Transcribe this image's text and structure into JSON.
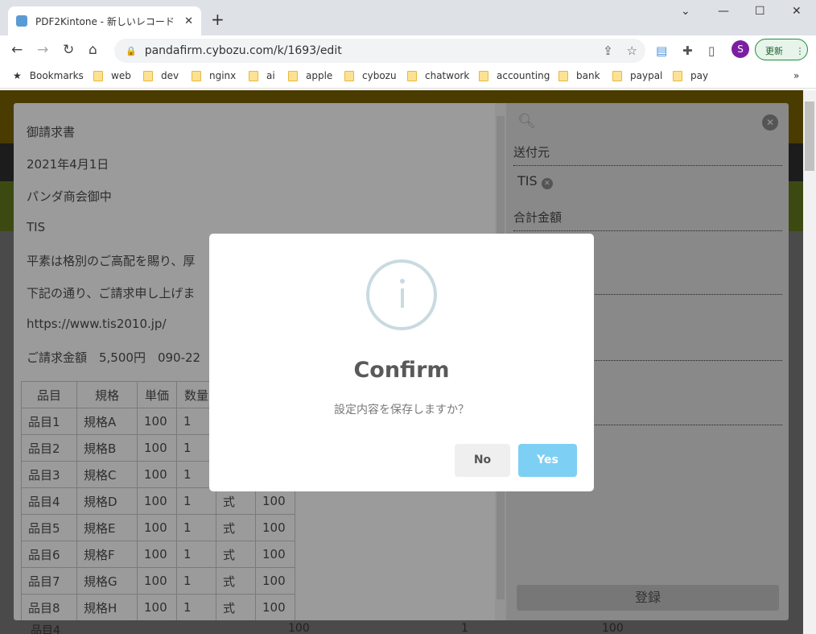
{
  "browser": {
    "tab_title": "PDF2Kintone - 新しいレコード",
    "url": "pandafirm.cybozu.com/k/1693/edit",
    "profile_initial": "S",
    "update_label": "更新",
    "bookmarks": [
      "Bookmarks",
      "web",
      "dev",
      "nginx",
      "ai",
      "apple",
      "cybozu",
      "chatwork",
      "accounting",
      "bank",
      "paypal",
      "pay"
    ]
  },
  "document": {
    "lines": [
      "御請求書",
      "2021年4月1日",
      "パンダ商会御中",
      "TIS",
      "平素は格別のご高配を賜り、厚",
      "下記の通り、ご請求申し上げま",
      "https://www.tis2010.jp/",
      "ご請求金額　5,500円　090-22"
    ],
    "table": {
      "headers": [
        "品目",
        "規格",
        "単価",
        "数量",
        "",
        ""
      ],
      "rows": [
        [
          "品目1",
          "規格A",
          "100",
          "1",
          "",
          ""
        ],
        [
          "品目2",
          "規格B",
          "100",
          "1",
          "",
          ""
        ],
        [
          "品目3",
          "規格C",
          "100",
          "1",
          "",
          ""
        ],
        [
          "品目4",
          "規格D",
          "100",
          "1",
          "式",
          "100"
        ],
        [
          "品目5",
          "規格E",
          "100",
          "1",
          "式",
          "100"
        ],
        [
          "品目6",
          "規格F",
          "100",
          "1",
          "式",
          "100"
        ],
        [
          "品目7",
          "規格G",
          "100",
          "1",
          "式",
          "100"
        ],
        [
          "品目8",
          "規格H",
          "100",
          "1",
          "式",
          "100"
        ]
      ]
    }
  },
  "background_row": [
    "品目4",
    "100",
    "1",
    "100"
  ],
  "sidebar": {
    "field1_label": "送付元",
    "field1_value": "TIS",
    "field2_label": "合計金額",
    "register_label": "登録"
  },
  "dialog": {
    "icon": "info-icon",
    "title": "Confirm",
    "message": "設定内容を保存しますか？",
    "no_label": "No",
    "yes_label": "Yes",
    "yes_color": "#7ecff4"
  }
}
